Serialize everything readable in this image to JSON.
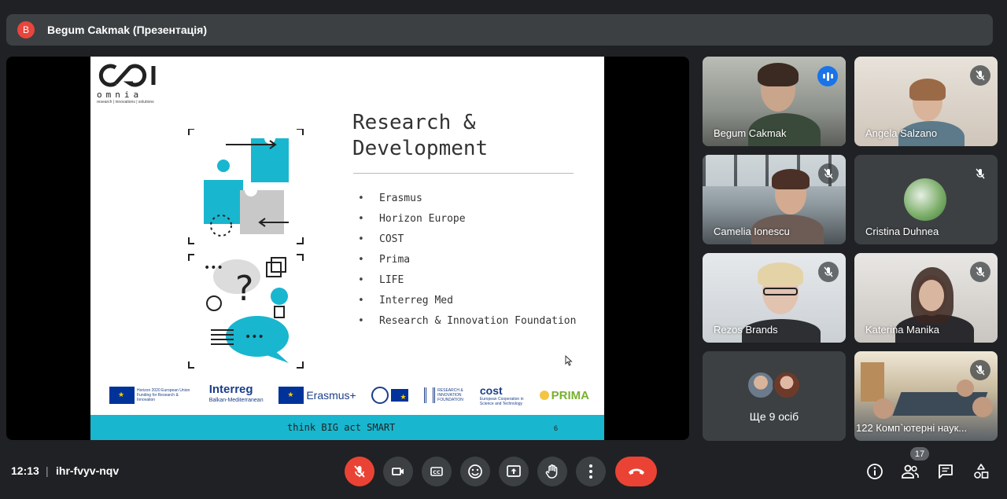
{
  "presenter_bar": {
    "avatar_letter": "B",
    "title": "Begum Cakmak (Презентація)"
  },
  "slide": {
    "logo_word": "omnia",
    "logo_tagline": "research | innovations | solutions",
    "title_line1": "Research &",
    "title_line2": "Development",
    "bullets": [
      "Erasmus",
      "Horizon Europe",
      "COST",
      "Prima",
      "LIFE",
      "Interreg Med",
      "Research & Innovation Foundation"
    ],
    "partners": {
      "horizon_text": "Horizon 2020 European Union Funding for Research & Innovation",
      "interreg": "Interreg",
      "interreg_sub": "Balkan-Mediterranean",
      "erasmus": "Erasmus+",
      "rif": "RESEARCH & INNOVATION FOUNDATION",
      "cost": "cost",
      "cost_sub": "European Cooperation in Science and Technology",
      "prima": "PRIMA"
    },
    "footer": "think BIG act SMART",
    "page_number": "6",
    "accent_color": "#19b6cf"
  },
  "participants": [
    {
      "name": "Begum Cakmak",
      "speaking": true
    },
    {
      "name": "Angela Salzano",
      "muted": true
    },
    {
      "name": "Camelia Ionescu",
      "muted": true
    },
    {
      "name": "Cristina Duhnea",
      "muted": true
    },
    {
      "name": "Rezos Brands",
      "muted": true
    },
    {
      "name": "Katerina Manika",
      "muted": true
    },
    {
      "name": "122 Комп`ютерні наук...",
      "muted": true
    }
  ],
  "more_participants": "Ще 9 осіб",
  "bottom_bar": {
    "time": "12:13",
    "separator": "|",
    "meeting_code": "ihr-fvyv-nqv",
    "people_count": "17",
    "controls": [
      "mic-off-icon",
      "camera-icon",
      "captions-icon",
      "emoji-icon",
      "present-icon",
      "raise-hand-icon",
      "more-options-icon",
      "hang-up-icon"
    ],
    "right_icons": [
      "info-icon",
      "people-icon",
      "chat-icon",
      "activities-icon"
    ]
  }
}
